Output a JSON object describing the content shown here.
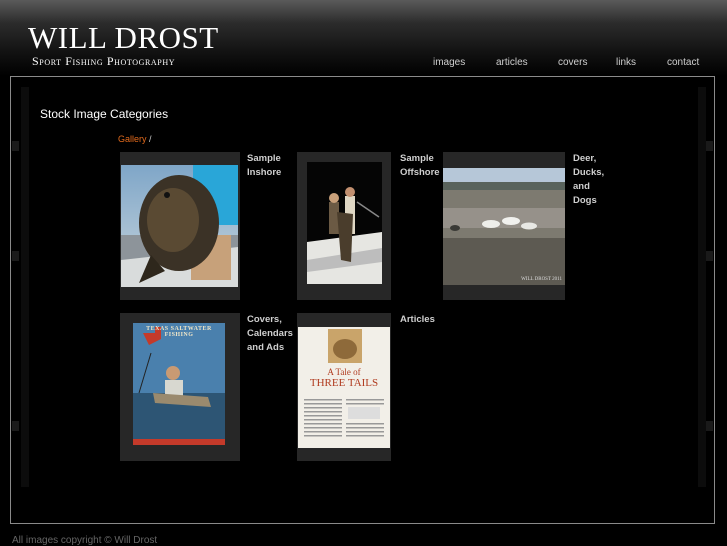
{
  "header": {
    "logo_name": "WILL DROST",
    "logo_tagline": "Sport Fishing Photography",
    "nav": [
      "images",
      "articles",
      "covers",
      "links",
      "contact"
    ]
  },
  "main": {
    "title": "Stock Image Categories",
    "breadcrumb": {
      "link": "Gallery",
      "separator": "/"
    },
    "categories": [
      {
        "label": "Sample Inshore"
      },
      {
        "label": "Sample Offshore"
      },
      {
        "label": "Deer, Ducks, and Dogs",
        "photo_credit": "WILL DROST 2011"
      },
      {
        "label": "Covers, Calendars and Ads",
        "cover_title": "TEXAS SALTWATER FISHING"
      },
      {
        "label": "Articles",
        "article_heading_top": "A Tale of",
        "article_heading_main": "THREE TAILS"
      }
    ]
  },
  "footer": {
    "copyright": "All images copyright © Will Drost"
  },
  "colors": {
    "accent": "#e26a1c",
    "tile": "#272727",
    "frame_border": "#8a8a8a"
  }
}
